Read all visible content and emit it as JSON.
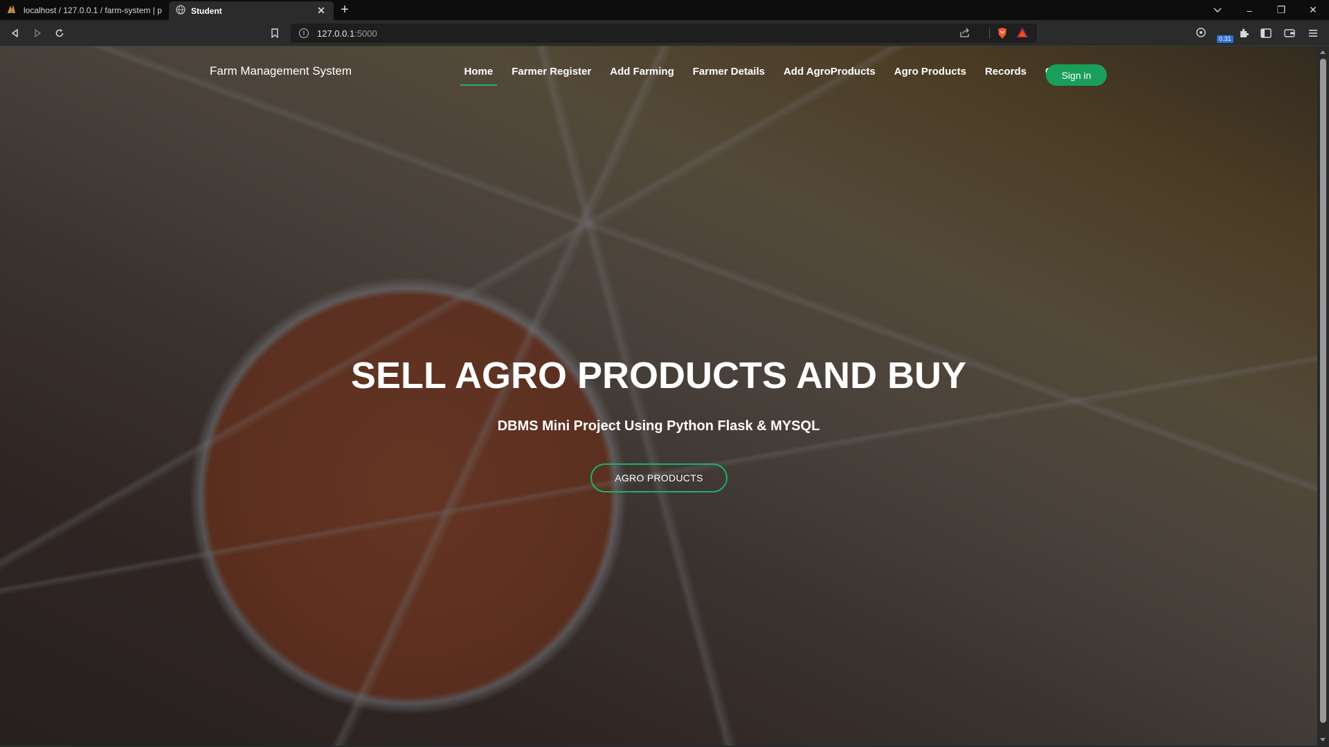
{
  "browser": {
    "tabs": [
      {
        "title": "localhost / 127.0.0.1 / farm-system | p",
        "icon": "phpmyadmin-icon",
        "active": false
      },
      {
        "title": "Student",
        "icon": "globe-icon",
        "active": true
      }
    ],
    "new_tab": "+",
    "url_host": "127.0.0.1",
    "url_port": ":5000",
    "extension_badge": "0.31",
    "window_controls": {
      "minimize": "–",
      "restore": "❐",
      "close": "✕"
    }
  },
  "site": {
    "brand": "Farm Management System",
    "nav": [
      {
        "label": "Home",
        "active": true
      },
      {
        "label": "Farmer Register"
      },
      {
        "label": "Add Farming"
      },
      {
        "label": "Farmer Details"
      },
      {
        "label": "Add AgroProducts"
      },
      {
        "label": "Agro Products"
      },
      {
        "label": "Records"
      },
      {
        "label": "Contact"
      }
    ],
    "signin": "Sign in"
  },
  "hero": {
    "title": "SELL AGRO PRODUCTS AND BUY",
    "subtitle": "DBMS Mini Project Using Python Flask & MYSQL",
    "button": "AGRO PRODUCTS"
  },
  "colors": {
    "accent": "#1bb36a",
    "signin_bg": "#1a9e5c"
  }
}
